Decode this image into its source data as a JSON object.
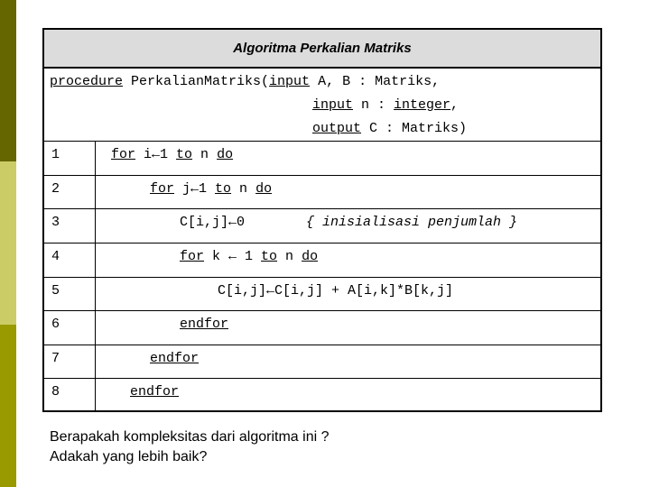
{
  "slide": {
    "band_colors": [
      "#666600",
      "#cccc66",
      "#999900"
    ],
    "table": {
      "title": "Algoritma Perkalian Matriks",
      "procedure": {
        "line1": {
          "kw1": "procedure",
          "text1": " PerkalianMatriks(",
          "kw2": "input",
          "text2": " A, B : Matriks,"
        },
        "line2": {
          "kw1": "input",
          "text1": " n : ",
          "kw2": "integer",
          "text2": ","
        },
        "line3": {
          "kw1": "output",
          "text1": " C : Matriks)"
        }
      },
      "rows": [
        {
          "num": "1",
          "parts": [
            {
              "t": "for",
              "u": true
            },
            {
              "t": " i←1 ",
              "u": false
            },
            {
              "t": "to",
              "u": true
            },
            {
              "t": " n ",
              "u": false
            },
            {
              "t": "do",
              "u": true
            }
          ]
        },
        {
          "num": "2",
          "parts": [
            {
              "t": "for",
              "u": true
            },
            {
              "t": " j←1 ",
              "u": false
            },
            {
              "t": "to",
              "u": true
            },
            {
              "t": " n ",
              "u": false
            },
            {
              "t": "do",
              "u": true
            }
          ]
        },
        {
          "num": "3",
          "parts": [
            {
              "t": "C[i,j]←0",
              "u": false
            }
          ],
          "comment": "{ inisialisasi penjumlah }"
        },
        {
          "num": "4",
          "parts": [
            {
              "t": "for",
              "u": true
            },
            {
              "t": " k ← 1 ",
              "u": false
            },
            {
              "t": "to",
              "u": true
            },
            {
              "t": " n ",
              "u": false
            },
            {
              "t": "do",
              "u": true
            }
          ]
        },
        {
          "num": "5",
          "parts": [
            {
              "t": "C[i,j]←C[i,j] + A[i,k]*B[k,j]",
              "u": false
            }
          ]
        },
        {
          "num": "6",
          "parts": [
            {
              "t": "endfor",
              "u": true
            }
          ]
        },
        {
          "num": "7",
          "parts": [
            {
              "t": "endfor",
              "u": true
            }
          ]
        },
        {
          "num": "8",
          "parts": [
            {
              "t": "endfor",
              "u": true
            }
          ]
        }
      ]
    },
    "question": {
      "line1": "Berapakah kompleksitas dari algoritma ini ?",
      "line2": "Adakah yang lebih baik?"
    }
  }
}
